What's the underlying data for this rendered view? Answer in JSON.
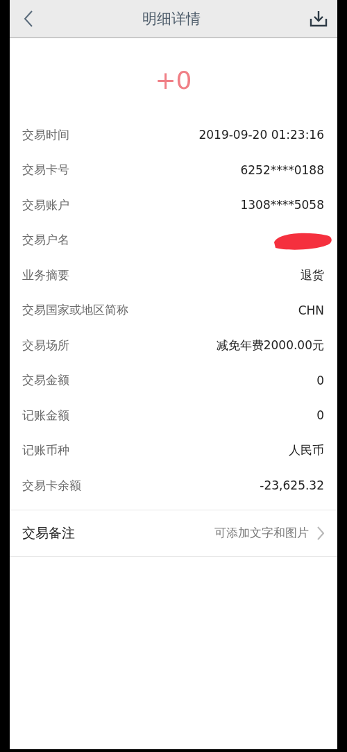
{
  "header": {
    "title": "明细详情"
  },
  "amount": "+0",
  "details": [
    {
      "label": "交易时间",
      "value": "2019-09-20 01:23:16"
    },
    {
      "label": "交易卡号",
      "value": "6252****0188"
    },
    {
      "label": "交易账户",
      "value": "1308****5058"
    },
    {
      "label": "交易户名",
      "kind": "redacted"
    },
    {
      "label": "业务摘要",
      "value": "退货"
    },
    {
      "label": "交易国家或地区简称",
      "value": "CHN"
    },
    {
      "label": "交易场所",
      "value": "减免年费2000.00元"
    },
    {
      "label": "交易金额",
      "value": "0"
    },
    {
      "label": "记账金额",
      "value": "0"
    },
    {
      "label": "记账币种",
      "value": "人民币"
    },
    {
      "label": "交易卡余额",
      "value": "-23,625.32"
    }
  ],
  "remark": {
    "label": "交易备注",
    "placeholder": "可添加文字和图片"
  }
}
